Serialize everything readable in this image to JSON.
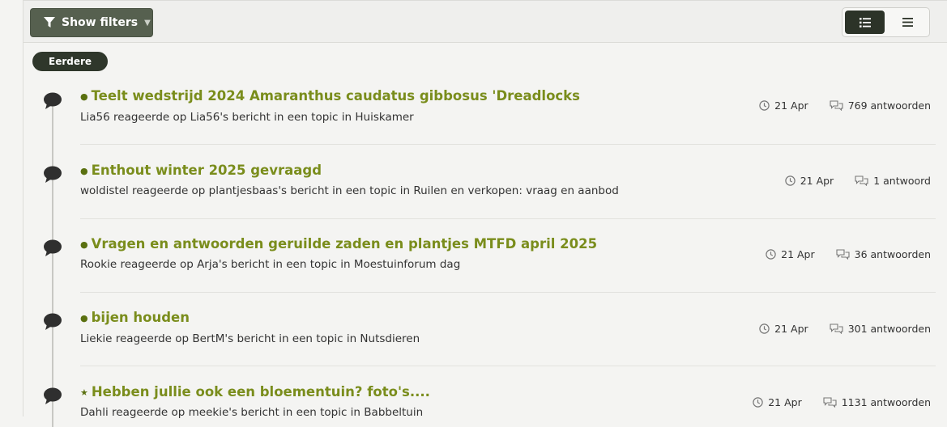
{
  "toolbar": {
    "filter_label": "Show filters",
    "filter_icon": "filter-icon",
    "view_list_icon": "list-detailed-icon",
    "view_compact_icon": "list-compact-icon"
  },
  "section_badge": "Eerdere",
  "colors": {
    "accent_green": "#7a8d1c",
    "dark_button": "#2c3328",
    "filter_button": "#56604f"
  },
  "items": [
    {
      "bullet": "●",
      "title": "Teelt wedstrijd 2024 Amaranthus caudatus gibbosus 'Dreadlocks",
      "subtitle": "Lia56 reageerde op Lia56's bericht in een topic in Huiskamer",
      "date": "21 Apr",
      "replies": "769 antwoorden"
    },
    {
      "bullet": "●",
      "title": "Enthout winter 2025 gevraagd",
      "subtitle": "woldistel reageerde op plantjesbaas's bericht in een topic in Ruilen en verkopen: vraag en aanbod",
      "date": "21 Apr",
      "replies": "1 antwoord"
    },
    {
      "bullet": "●",
      "title": "Vragen en antwoorden geruilde zaden en plantjes MTFD april 2025",
      "subtitle": "Rookie reageerde op Arja's bericht in een topic in Moestuinforum dag",
      "date": "21 Apr",
      "replies": "36 antwoorden"
    },
    {
      "bullet": "●",
      "title": "bijen houden",
      "subtitle": "Liekie reageerde op BertM's bericht in een topic in Nutsdieren",
      "date": "21 Apr",
      "replies": "301 antwoorden"
    },
    {
      "bullet": "★",
      "title": "Hebben jullie ook een bloementuin? foto's....",
      "subtitle": "Dahli reageerde op meekie's bericht in een topic in Babbeltuin",
      "date": "21 Apr",
      "replies": "1131 antwoorden"
    }
  ]
}
